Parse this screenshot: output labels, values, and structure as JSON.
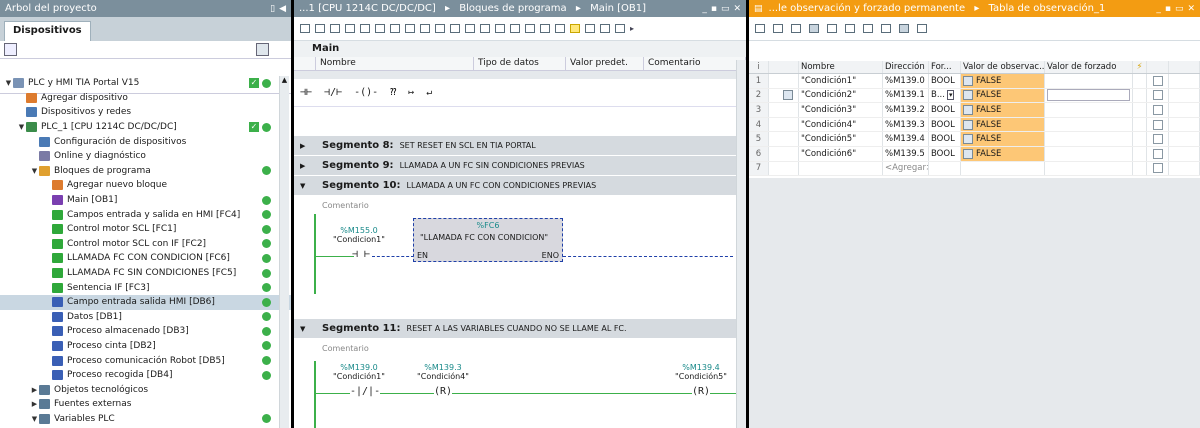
{
  "tree_pane": {
    "title": "Árbol del proyecto",
    "tab": "Dispositivos",
    "items": [
      {
        "label": "PLC y HMI TIA Portal V15",
        "level": 0,
        "exp": "▼",
        "icon_color": "#7a93b5",
        "check": true,
        "dot": true
      },
      {
        "label": "Agregar dispositivo",
        "level": 1,
        "exp": "",
        "icon_color": "#dd7b2e",
        "check": false,
        "dot": false
      },
      {
        "label": "Dispositivos y redes",
        "level": 1,
        "exp": "",
        "icon_color": "#4a7ab5",
        "check": false,
        "dot": false
      },
      {
        "label": "PLC_1 [CPU 1214C DC/DC/DC]",
        "level": 1,
        "exp": "▼",
        "icon_color": "#3b8c4a",
        "check": true,
        "dot": true
      },
      {
        "label": "Configuración de dispositivos",
        "level": 2,
        "exp": "",
        "icon_color": "#4a7ab5",
        "check": false,
        "dot": false
      },
      {
        "label": "Online y diagnóstico",
        "level": 2,
        "exp": "",
        "icon_color": "#7a7aa5",
        "check": false,
        "dot": false
      },
      {
        "label": "Bloques de programa",
        "level": 2,
        "exp": "▼",
        "icon_color": "#e0a030",
        "check": false,
        "dot": true
      },
      {
        "label": "Agregar nuevo bloque",
        "level": 3,
        "exp": "",
        "icon_color": "#dd7b2e",
        "check": false,
        "dot": false
      },
      {
        "label": "Main [OB1]",
        "level": 3,
        "exp": "",
        "icon_color": "#7a3fb0",
        "check": false,
        "dot": true
      },
      {
        "label": "Campos entrada y salida en HMI [FC4]",
        "level": 3,
        "exp": "",
        "icon_color": "#2fa83a",
        "check": false,
        "dot": true
      },
      {
        "label": "Control motor SCL [FC1]",
        "level": 3,
        "exp": "",
        "icon_color": "#2fa83a",
        "check": false,
        "dot": true
      },
      {
        "label": "Control motor SCL con IF [FC2]",
        "level": 3,
        "exp": "",
        "icon_color": "#2fa83a",
        "check": false,
        "dot": true
      },
      {
        "label": "LLAMADA FC CON CONDICION [FC6]",
        "level": 3,
        "exp": "",
        "icon_color": "#2fa83a",
        "check": false,
        "dot": true
      },
      {
        "label": "LLAMADA FC SIN CONDICIONES [FC5]",
        "level": 3,
        "exp": "",
        "icon_color": "#2fa83a",
        "check": false,
        "dot": true
      },
      {
        "label": "Sentencia IF [FC3]",
        "level": 3,
        "exp": "",
        "icon_color": "#2fa83a",
        "check": false,
        "dot": true
      },
      {
        "label": "Campo entrada salida HMI [DB6]",
        "level": 3,
        "exp": "",
        "icon_color": "#3a5fb5",
        "check": false,
        "dot": true,
        "selected": true
      },
      {
        "label": "Datos [DB1]",
        "level": 3,
        "exp": "",
        "icon_color": "#3a5fb5",
        "check": false,
        "dot": true
      },
      {
        "label": "Proceso almacenado [DB3]",
        "level": 3,
        "exp": "",
        "icon_color": "#3a5fb5",
        "check": false,
        "dot": true
      },
      {
        "label": "Proceso cinta [DB2]",
        "level": 3,
        "exp": "",
        "icon_color": "#3a5fb5",
        "check": false,
        "dot": true
      },
      {
        "label": "Proceso comunicación Robot [DB5]",
        "level": 3,
        "exp": "",
        "icon_color": "#3a5fb5",
        "check": false,
        "dot": true
      },
      {
        "label": "Proceso recogida [DB4]",
        "level": 3,
        "exp": "",
        "icon_color": "#3a5fb5",
        "check": false,
        "dot": true
      },
      {
        "label": "Objetos tecnológicos",
        "level": 2,
        "exp": "▶",
        "icon_color": "#5a7a95",
        "check": false,
        "dot": false
      },
      {
        "label": "Fuentes externas",
        "level": 2,
        "exp": "▶",
        "icon_color": "#5a7a95",
        "check": false,
        "dot": false
      },
      {
        "label": "Variables PLC",
        "level": 2,
        "exp": "▼",
        "icon_color": "#5a7a95",
        "check": false,
        "dot": true
      }
    ]
  },
  "editor_pane": {
    "breadcrumb": [
      "...1 [CPU 1214C DC/DC/DC]",
      "Bloques de programa",
      "Main [OB1]"
    ],
    "block_name": "Main",
    "iface_cols": [
      "Nombre",
      "Tipo de datos",
      "Valor predet.",
      "Comentario"
    ],
    "ladder_tools": [
      "⊣⊢",
      "⊣/⊢",
      "-()-",
      "⁇",
      "↦",
      "↵"
    ],
    "segments": [
      {
        "name": "Segmento 8:",
        "desc": "SET RESET EN SCL EN TIA PORTAL",
        "arrow": "▶"
      },
      {
        "name": "Segmento 9:",
        "desc": "LLAMADA A UN FC SIN CONDICIONES PREVIAS",
        "arrow": "▶"
      },
      {
        "name": "Segmento 10:",
        "desc": "LLAMADA A UN FC CON CONDICIONES PREVIAS",
        "arrow": "▼"
      },
      {
        "name": "Segmento 11:",
        "desc": "RESET A LAS VARIABLES CUANDO NO SE LLAME AL FC.",
        "arrow": "▼"
      }
    ],
    "comment_label": "Comentario",
    "seg10": {
      "contact_tag": "%M155.0",
      "contact_name": "\"Condicion1\"",
      "fc_tag": "%FC6",
      "fc_name": "\"LLAMADA FC CON CONDICION\"",
      "en": "EN",
      "eno": "ENO"
    },
    "seg11": {
      "c1_tag": "%M139.0",
      "c1_name": "\"Condición1\"",
      "c1_sym": "-|/|-",
      "c2_tag": "%M139.3",
      "c2_name": "\"Condición4\"",
      "c2_sym": "(R)",
      "c3_tag": "%M139.4",
      "c3_name": "\"Condición5\"",
      "c3_sym": "(R)"
    }
  },
  "watch_pane": {
    "breadcrumb": [
      "...le observación y forzado permanente",
      "Tabla de observación_1"
    ],
    "columns": [
      "i",
      "",
      "Nombre",
      "Dirección",
      "For...",
      "Valor de observac...",
      "Valor de forzado",
      "⚡"
    ],
    "rows": [
      {
        "idx": "1",
        "name": "\"Condición1\"",
        "addr": "%M139.0",
        "fmt": "BOOL",
        "mon": "FALSE"
      },
      {
        "idx": "2",
        "name": "\"Condición2\"",
        "addr": "%M139.1",
        "fmt": "B...",
        "mon": "FALSE",
        "editing": true
      },
      {
        "idx": "3",
        "name": "\"Condición3\"",
        "addr": "%M139.2",
        "fmt": "BOOL",
        "mon": "FALSE"
      },
      {
        "idx": "4",
        "name": "\"Condición4\"",
        "addr": "%M139.3",
        "fmt": "BOOL",
        "mon": "FALSE"
      },
      {
        "idx": "5",
        "name": "\"Condición5\"",
        "addr": "%M139.4",
        "fmt": "BOOL",
        "mon": "FALSE"
      },
      {
        "idx": "6",
        "name": "\"Condición6\"",
        "addr": "%M139.5",
        "fmt": "BOOL",
        "mon": "FALSE"
      }
    ],
    "add_row": {
      "idx": "7",
      "label": "<Agregar>"
    }
  },
  "colors": {
    "title_gray": "#7b8f9c",
    "title_orange": "#f39c12",
    "status_green": "#3cb04a",
    "monitor_orange": "#fdc776",
    "tag_teal": "#1a8a8a"
  }
}
